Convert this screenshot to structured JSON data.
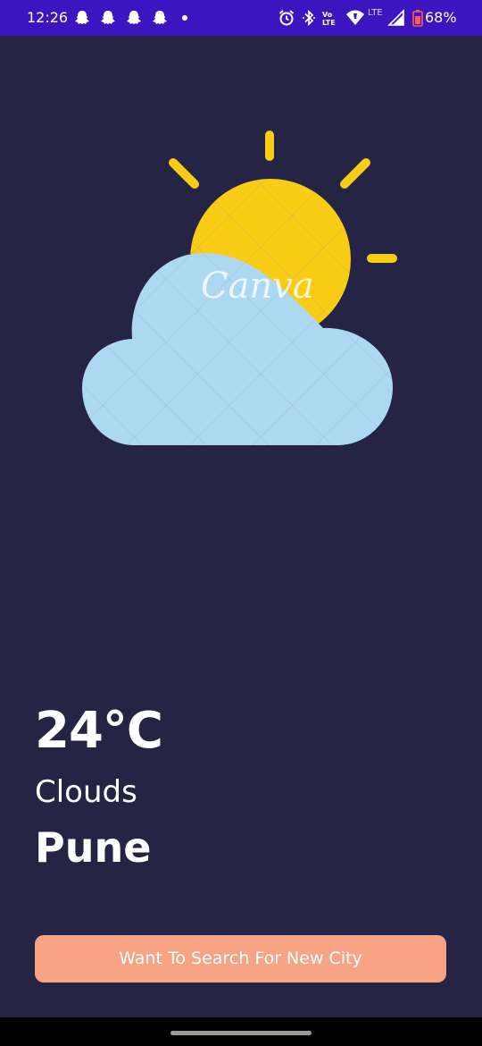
{
  "status_bar": {
    "time": "12:26",
    "network_label": "LTE",
    "volte_label": "Vo LTE",
    "battery_text": "68%",
    "battery_level": 0.68
  },
  "weather": {
    "temperature": "24°C",
    "condition": "Clouds",
    "city": "Pune",
    "icon": "partly-cloudy-icon",
    "watermark": "Canva"
  },
  "actions": {
    "search_label": "Want To Search For New City"
  },
  "colors": {
    "background": "#262444",
    "status_bar": "#3b16c0",
    "button": "#f9a385",
    "sun": "#f9cc15",
    "cloud": "#acd9f1"
  }
}
